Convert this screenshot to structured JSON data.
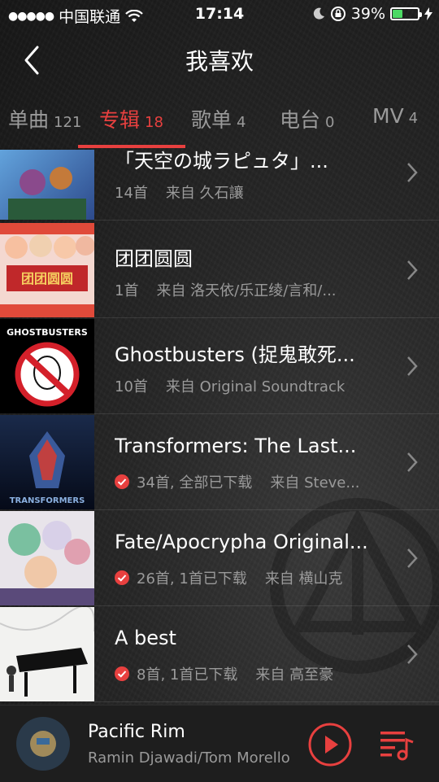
{
  "status_bar": {
    "carrier": "中国联通",
    "time": "17:14",
    "battery": "39%",
    "battery_level": 0.39,
    "colors": {
      "battery_fill": "#4cd964"
    }
  },
  "nav": {
    "title": "我喜欢",
    "back_icon": "chevron-left-icon"
  },
  "tabs": [
    {
      "label": "单曲",
      "count": "121",
      "active": false
    },
    {
      "label": "专辑",
      "count": "18",
      "active": true
    },
    {
      "label": "歌单",
      "count": "4",
      "active": false
    },
    {
      "label": "电台",
      "count": "0",
      "active": false
    },
    {
      "label": "MV",
      "count": "4",
      "active": false
    }
  ],
  "accent_color": "#e8403f",
  "albums": [
    {
      "title": "「天空の城ラピュタ」...",
      "count": "14首",
      "from": "来自 久石讓",
      "downloaded": false
    },
    {
      "title": "团团圆圆",
      "count": "1首",
      "from": "来自 洛天依/乐正绫/言和/...",
      "downloaded": false
    },
    {
      "title": "Ghostbusters (捉鬼敢死...",
      "count": "10首",
      "from": "来自 Original Soundtrack",
      "downloaded": false
    },
    {
      "title": "Transformers: The Last...",
      "count": "34首, 全部已下载",
      "from": "来自 Steve...",
      "downloaded": true
    },
    {
      "title": "Fate/Apocrypha Original...",
      "count": "26首, 1首已下载",
      "from": "来自 横山克",
      "downloaded": true
    },
    {
      "title": "A best",
      "count": "8首, 1首已下载",
      "from": "来自 高至豪",
      "downloaded": true
    }
  ],
  "cover_text": {
    "ghostbusters": "GHOSTBUSTERS",
    "tuantuan": "团团圆圆",
    "transformers": "TRANSFORMERS"
  },
  "player": {
    "title": "Pacific Rim",
    "artist": "Ramin Djawadi/Tom Morello",
    "play_icon": "play-icon",
    "queue_icon": "playlist-icon"
  }
}
